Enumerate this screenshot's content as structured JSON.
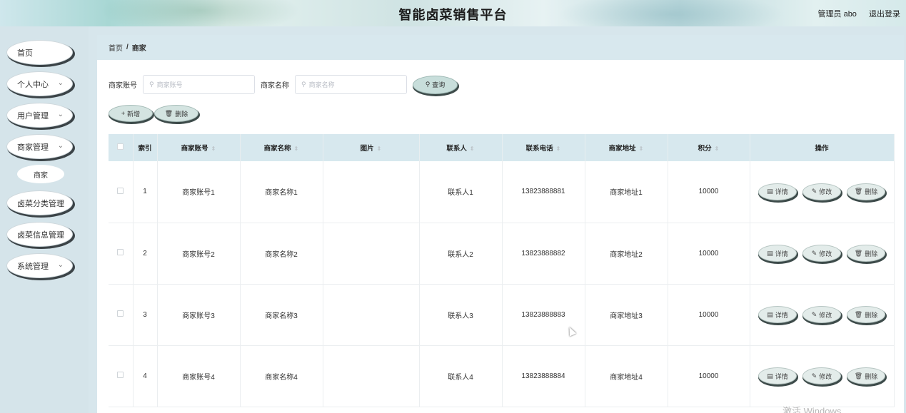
{
  "header": {
    "title": "智能卤菜销售平台",
    "admin": "管理员 abo",
    "logout": "退出登录"
  },
  "sidebar": {
    "items": [
      {
        "label": "首页",
        "has_chevron": false
      },
      {
        "label": "个人中心",
        "has_chevron": true
      },
      {
        "label": "用户管理",
        "has_chevron": true
      },
      {
        "label": "商家管理",
        "has_chevron": true
      },
      {
        "label": "卤菜分类管理",
        "has_chevron": false
      },
      {
        "label": "卤菜信息管理",
        "has_chevron": false
      },
      {
        "label": "系统管理",
        "has_chevron": true
      }
    ],
    "sub_item": "商家"
  },
  "breadcrumb": {
    "home": "首页",
    "separator": "/",
    "current": "商家"
  },
  "search": {
    "account_label": "商家账号",
    "account_placeholder": "商家账号",
    "name_label": "商家名称",
    "name_placeholder": "商家名称",
    "query_button": "查询"
  },
  "actions": {
    "add": "新增",
    "delete": "删除"
  },
  "table": {
    "columns": [
      "索引",
      "商家账号",
      "商家名称",
      "图片",
      "联系人",
      "联系电话",
      "商家地址",
      "积分",
      "操作"
    ],
    "rows": [
      {
        "index": "1",
        "account": "商家账号1",
        "name": "商家名称1",
        "image": "",
        "contact": "联系人1",
        "phone": "13823888881",
        "address": "商家地址1",
        "points": "10000"
      },
      {
        "index": "2",
        "account": "商家账号2",
        "name": "商家名称2",
        "image": "",
        "contact": "联系人2",
        "phone": "13823888882",
        "address": "商家地址2",
        "points": "10000"
      },
      {
        "index": "3",
        "account": "商家账号3",
        "name": "商家名称3",
        "image": "",
        "contact": "联系人3",
        "phone": "13823888883",
        "address": "商家地址3",
        "points": "10000"
      },
      {
        "index": "4",
        "account": "商家账号4",
        "name": "商家名称4",
        "image": "",
        "contact": "联系人4",
        "phone": "13823888884",
        "address": "商家地址4",
        "points": "10000"
      }
    ],
    "row_actions": {
      "detail": "详情",
      "edit": "修改",
      "delete": "删除"
    }
  },
  "watermark": "激活 Windows",
  "colors": {
    "sidebar_bg": "#d5e4ea",
    "header_row_bg": "#d7e8ee",
    "button_bg": "#c8dedb"
  }
}
